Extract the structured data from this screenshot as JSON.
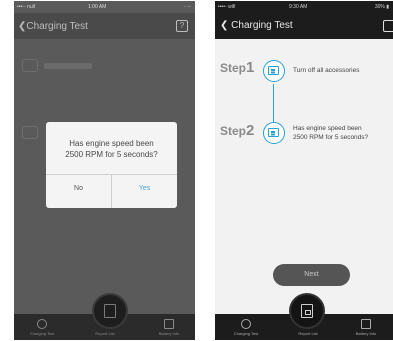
{
  "left": {
    "status": {
      "carrier": "•••◦◦ null",
      "time": "1:00 AM",
      "battery": "◦ ◦◦"
    },
    "nav": {
      "back_label": "❮Charging Test",
      "help_icon": "?"
    },
    "dialog": {
      "message_line1": "Has engine speed been",
      "message_line2": "2500 RPM for 5 seconds?",
      "no_label": "No",
      "yes_label": "Yes"
    },
    "tabs": [
      {
        "label": "Charging Test",
        "icon": "gauge-icon"
      },
      {
        "label": "Report List",
        "icon": "report-icon"
      },
      {
        "label": "Battery Info",
        "icon": "battery-icon"
      }
    ]
  },
  "right": {
    "status": {
      "carrier": "••••◦ wifi",
      "time": "9:30 AM",
      "battery": "30% ▮"
    },
    "nav": {
      "back_label": "❮ Charging Test"
    },
    "steps": [
      {
        "word": "Step",
        "number": "1",
        "text_line1": "Turn off all accessories",
        "text_line2": ""
      },
      {
        "word": "Step",
        "number": "2",
        "text_line1": "Has engine speed been",
        "text_line2": "2500 RPM for 5 seconds?"
      }
    ],
    "next_label": "Next",
    "tabs": [
      {
        "label": "Charging Test",
        "icon": "gauge-icon"
      },
      {
        "label": "Report List",
        "icon": "report-icon"
      },
      {
        "label": "Battery Info",
        "icon": "battery-icon"
      }
    ]
  },
  "colors": {
    "accent": "#28a0d8",
    "dialog_yes": "#4a9fd8"
  }
}
